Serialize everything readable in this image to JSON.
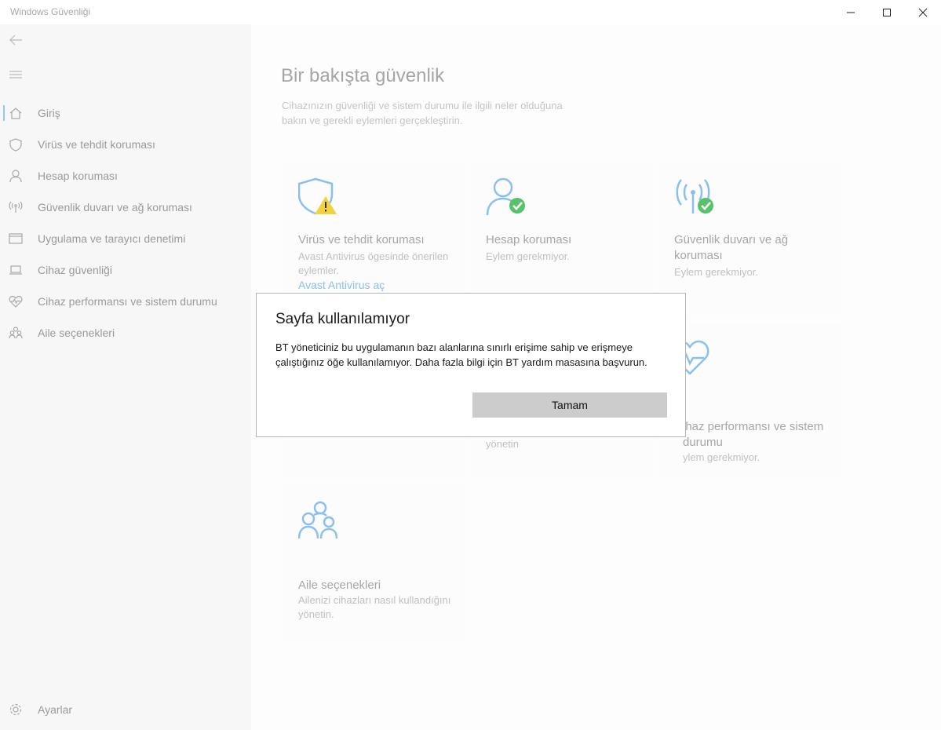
{
  "window": {
    "title": "Windows Güvenliği"
  },
  "sidebar": {
    "items": [
      {
        "label": "Giriş",
        "icon": "home-icon",
        "active": true
      },
      {
        "label": "Virüs ve tehdit koruması",
        "icon": "shield-icon"
      },
      {
        "label": "Hesap koruması",
        "icon": "person-icon"
      },
      {
        "label": "Güvenlik duvarı ve ağ koruması",
        "icon": "antenna-icon"
      },
      {
        "label": "Uygulama ve tarayıcı denetimi",
        "icon": "browser-window-icon"
      },
      {
        "label": "Cihaz güvenliği",
        "icon": "laptop-icon"
      },
      {
        "label": "Cihaz performansı ve sistem durumu",
        "icon": "heart-pulse-icon"
      },
      {
        "label": "Aile seçenekleri",
        "icon": "family-icon"
      }
    ],
    "settings_label": "Ayarlar"
  },
  "main": {
    "title": "Bir bakışta güvenlik",
    "subtitle": "Cihazınızın güvenliği ve sistem durumu ile ilgili neler olduğuna bakın ve gerekli eylemleri gerçekleştirin.",
    "cards": {
      "virus": {
        "title": "Virüs ve tehdit koruması",
        "desc": "Avast Antivirus ögesinde önerilen eylemler.",
        "link": "Avast Antivirus aç",
        "icon": "shield-warning-icon"
      },
      "account": {
        "title": "Hesap koruması",
        "desc": "Eylem gerekmiyor.",
        "icon": "person-check-icon"
      },
      "firewall": {
        "title": "Güvenlik duvarı ve ağ koruması",
        "desc": "Eylem gerekmiyor.",
        "icon": "antenna-check-icon"
      },
      "performance": {
        "title_visible": "ihaz performansı ve sistem durumu",
        "desc_visible": "ylem gerekmiyor.",
        "icon": "heart-pulse-icon"
      },
      "app_browser": {
        "desc_visible": "yönetin"
      },
      "family": {
        "title": "Aile seçenekleri",
        "desc": "Ailenizi cihazları nasıl kullandığını yönetin.",
        "icon": "family-icon"
      }
    }
  },
  "dialog": {
    "title": "Sayfa kullanılamıyor",
    "body": "BT yöneticiniz bu uygulamanın bazı alanlarına sınırlı erişime sahip ve erişmeye çalıştığınız öğe kullanılamıyor. Daha fazla bilgi için BT yardım masasına başvurun.",
    "button": "Tamam"
  },
  "colors": {
    "accent": "#8cc0ec",
    "ok_green": "#57c26a",
    "warning_yellow": "#f4d13e"
  }
}
